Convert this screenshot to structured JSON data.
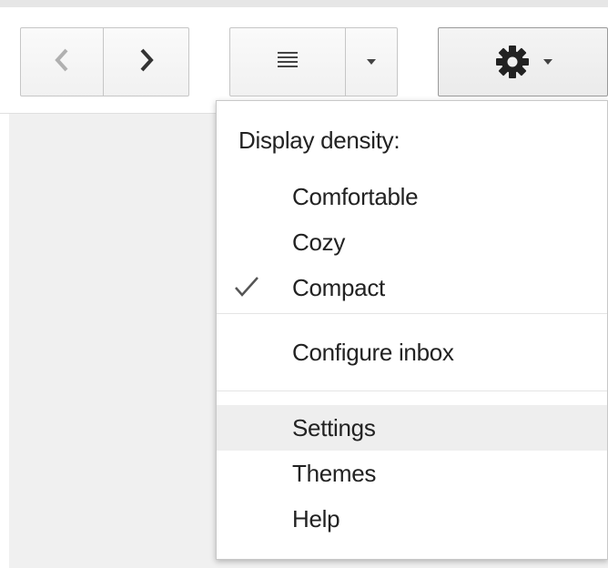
{
  "toolbar": {
    "prev_icon": "chevron-left-icon",
    "next_icon": "chevron-right-icon",
    "density_icon": "density-lines-icon",
    "density_caret_icon": "caret-down-icon",
    "settings_icon": "gear-icon",
    "settings_caret_icon": "caret-down-icon"
  },
  "menu": {
    "heading": "Display density:",
    "density_options": [
      {
        "label": "Comfortable",
        "checked": false
      },
      {
        "label": "Cozy",
        "checked": false
      },
      {
        "label": "Compact",
        "checked": true
      }
    ],
    "configure_label": "Configure inbox",
    "settings_label": "Settings",
    "themes_label": "Themes",
    "help_label": "Help",
    "check_icon": "checkmark-icon",
    "highlighted_item": "Settings"
  },
  "colors": {
    "menu_highlight": "#eeeeee",
    "content_background": "#f0f0f0",
    "icon_color": "#444444"
  }
}
